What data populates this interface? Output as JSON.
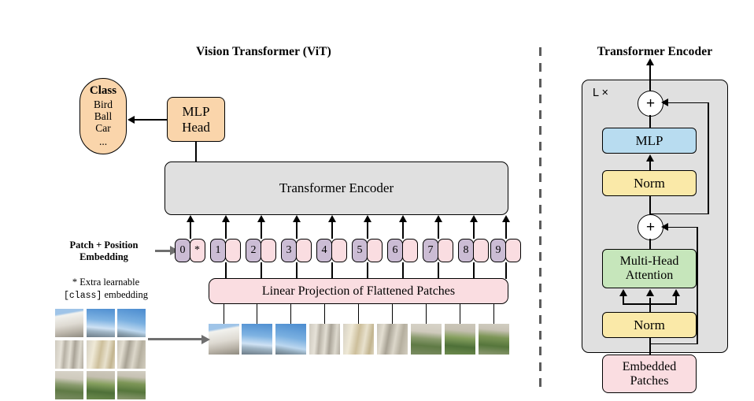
{
  "figure": {
    "left_panel_title": "Vision Transformer (ViT)",
    "right_panel_title": "Transformer Encoder"
  },
  "class_head": {
    "heading": "Class",
    "items": [
      "Bird",
      "Ball",
      "Car",
      "..."
    ],
    "mlp_head_line1": "MLP",
    "mlp_head_line2": "Head"
  },
  "encoder_block": {
    "label": "Transformer Encoder"
  },
  "embedding": {
    "label_line1": "Patch + Position",
    "label_line2": "Embedding",
    "footnote_line1": "* Extra learnable",
    "footnote_code": "[class]",
    "footnote_line2_tail": " embedding",
    "tokens": [
      "0",
      "1",
      "2",
      "3",
      "4",
      "5",
      "6",
      "7",
      "8",
      "9"
    ],
    "star": "*"
  },
  "projection": {
    "label": "Linear Projection of Flattened Patches"
  },
  "encoder_detail": {
    "repeat_label": "L ×",
    "mlp": "MLP",
    "norm_top": "Norm",
    "attention_line1": "Multi-Head",
    "attention_line2": "Attention",
    "norm_bottom": "Norm",
    "embedded_line1": "Embedded",
    "embedded_line2": "Patches",
    "plus_glyph": "+"
  },
  "colors": {
    "orange": "#fad5ab",
    "pink": "#fadde1",
    "purple": "#cbbcd4",
    "gray_panel": "#e0e0e0",
    "blue": "#b8dcf0",
    "yellow": "#fae9a8",
    "green": "#c6e6bb",
    "divider": "#5c5c5c",
    "gray_arrow": "#6f6f6f"
  },
  "patch_grid": {
    "rows": 3,
    "cols": 3,
    "description": "3x3 image patches of a palace facade"
  },
  "patch_strip": {
    "count": 9
  }
}
